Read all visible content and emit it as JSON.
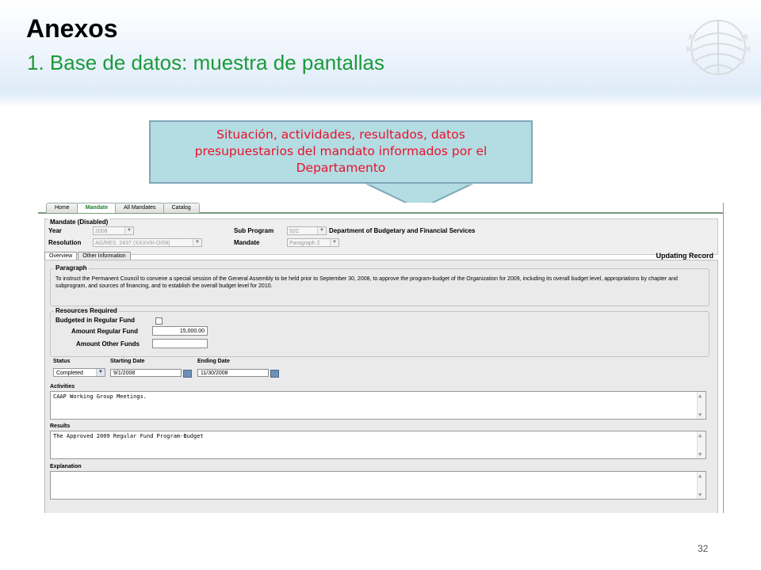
{
  "slide": {
    "title": "Anexos",
    "subtitle": "1. Base de datos: muestra de pantallas",
    "callout": [
      "Situación, actividades, resultados, datos",
      "presupuestarios del mandato informados por el",
      "Departamento"
    ],
    "page_number": "32"
  },
  "app": {
    "tabs": [
      "Home",
      "Mandate",
      "All Mandates",
      "Catalog"
    ],
    "active_tab": "Mandate",
    "mandate_legend": "Mandate (Disabled)",
    "year_label": "Year",
    "year_value": "2008",
    "resolution_label": "Resolution",
    "resolution_value": "AG/RES. 2437 (XXXVIII-O/08)",
    "subprogram_label": "Sub Program",
    "subprogram_value": "92C",
    "subprogram_name": "Department of Budgetary and Financial Services",
    "mandate_label": "Mandate",
    "mandate_value": "Paragraph 2",
    "subtabs": [
      "Overview",
      "Other Information"
    ],
    "status_banner": "Updating Record",
    "paragraph_legend": "Paragraph",
    "paragraph_text": "To instruct the Permanent Council to convene a special session of the General Assembly to be held prior to September 30, 2008, to approve the program-budget of the Organization for 2009, including its overall budget level, appropriations by chapter and subprogram, and sources of financing, and to establish the overall budget level for 2010.",
    "resources_legend": "Resources Required",
    "budgeted_label": "Budgeted in Regular Fund",
    "amount_regular_label": "Amount Regular Fund",
    "amount_regular_value": "15,000.00",
    "amount_other_label": "Amount Other Funds",
    "amount_other_value": "",
    "status_label": "Status",
    "status_value": "Completed",
    "start_label": "Starting Date",
    "start_value": "9/1/2008",
    "end_label": "Ending Date",
    "end_value": "11/30/2008",
    "activities_label": "Activities",
    "activities_value": "CAAP Working Group Meetings.",
    "results_label": "Results",
    "results_value": "The Approved 2009 Regular Fund Program-Budget",
    "explanation_label": "Explanation",
    "explanation_value": ""
  },
  "colors": {
    "subtitle": "#1a9a3a",
    "callout_text": "#e8122b",
    "callout_fill": "#b3dce3"
  }
}
